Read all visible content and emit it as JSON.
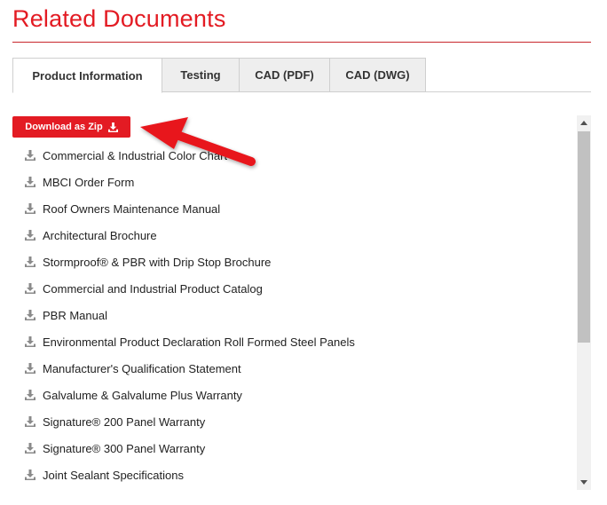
{
  "page": {
    "title": "Related Documents"
  },
  "tabs": [
    {
      "label": "Product Information",
      "active": true
    },
    {
      "label": "Testing",
      "active": false
    },
    {
      "label": "CAD (PDF)",
      "active": false
    },
    {
      "label": "CAD (DWG)",
      "active": false
    }
  ],
  "download_zip": {
    "label": "Download as Zip",
    "icon": "download-icon"
  },
  "documents": [
    {
      "label": "Commercial & Industrial Color Chart"
    },
    {
      "label": "MBCI Order Form"
    },
    {
      "label": "Roof Owners Maintenance Manual"
    },
    {
      "label": "Architectural Brochure"
    },
    {
      "label": "Stormproof® & PBR with Drip Stop Brochure"
    },
    {
      "label": "Commercial and Industrial Product Catalog"
    },
    {
      "label": "PBR Manual"
    },
    {
      "label": "Environmental Product Declaration Roll Formed Steel Panels"
    },
    {
      "label": "Manufacturer's Qualification Statement"
    },
    {
      "label": "Galvalume & Galvalume Plus Warranty"
    },
    {
      "label": "Signature® 200 Panel Warranty"
    },
    {
      "label": "Signature® 300 Panel Warranty"
    },
    {
      "label": "Joint Sealant Specifications"
    }
  ],
  "colors": {
    "accent": "#e31b23",
    "arrow": "#e8141c",
    "icon": "#8a8a8a"
  }
}
